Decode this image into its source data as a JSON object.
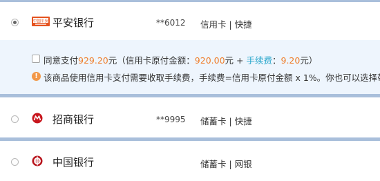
{
  "banks": [
    {
      "name": "平安银行",
      "card_no": "**6012",
      "card_type": "信用卡 | 快捷",
      "selected": true
    },
    {
      "name": "招商银行",
      "card_no": "**9995",
      "card_type": "储蓄卡 | 快捷",
      "selected": false
    },
    {
      "name": "中国银行",
      "card_no": "",
      "card_type": "储蓄卡 | 网银",
      "selected": false
    }
  ],
  "pingan_logo_text": "中国平安",
  "fee_notice": {
    "agree_prefix": "同意支付",
    "agree_amount": "929.20",
    "agree_unit": "元",
    "detail_open": "（信用卡原付金额：",
    "original_amount": "920.00",
    "plus": "元 + ",
    "fee_label": "手续费",
    "fee_colon": "：",
    "fee_amount": "9.20",
    "close": "元）",
    "warning_text": "该商品使用信用卡支付需要收取手续费，手续费=信用卡原付金额 x 1%。你也可以选择带有"
  },
  "colors": {
    "accent_orange": "#ef7d29",
    "fee_teal": "#21a3c9",
    "separator": "#a9bfdb",
    "panel_bg": "#eef5fd"
  }
}
